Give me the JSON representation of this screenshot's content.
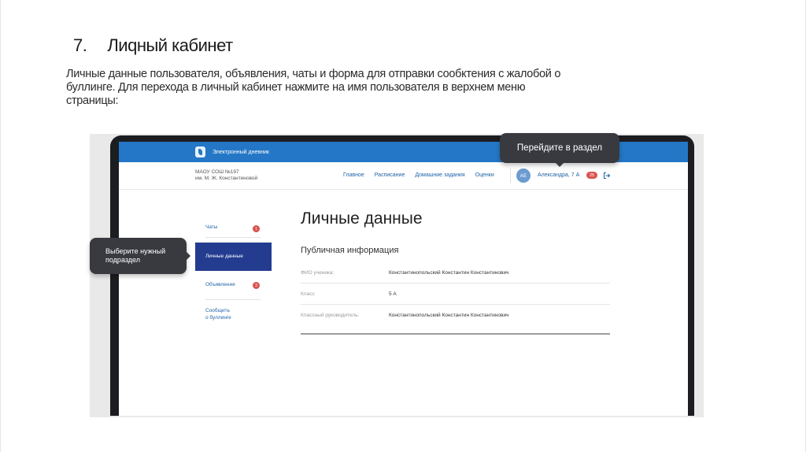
{
  "slide": {
    "number": "7.",
    "title": "Лиqный кабинет",
    "description": "Личные данные пользователя, объявления, чаты и форма для отправки сообктения с жалобой о буллинге. Для перехода в личный кабинет нажмите на имя пользователя в верхнем меню страницы:"
  },
  "app": {
    "name": "Электронный дневник",
    "school_line1": "МАОУ СОШ №197",
    "school_line2": "им. М. Ж. Константиновой",
    "nav": [
      "Главное",
      "Расписание",
      "Домашние задания",
      "Оценки"
    ],
    "avatar_initials": "АЕ",
    "user_name": "Александра, 7 А",
    "messages_count": "25",
    "logout_icon": "logout-icon",
    "accent_color": "#2477c6"
  },
  "sidebar": {
    "chats": "Чаты",
    "chats_badge": "1",
    "personal_data": "Личные данные",
    "ads": "Объявления",
    "ads_badge": "3",
    "report_line1": "Сообщить",
    "report_line2": "о буллинге",
    "active_color": "#243c90"
  },
  "content": {
    "heading": "Личные данные",
    "section": "Публичная информация",
    "rows": [
      {
        "label": "ФИО ученика:",
        "value": "Константинопольский Константин Константинович"
      },
      {
        "label": "Класс",
        "value": "5 А"
      },
      {
        "label": "Классный руководитель:",
        "value": "Константинопольский Константин Константинович"
      }
    ]
  },
  "tooltips": {
    "top": "Перейдите в раздел",
    "left_line1": "Выберите нужный",
    "left_line2": "подраздел"
  }
}
